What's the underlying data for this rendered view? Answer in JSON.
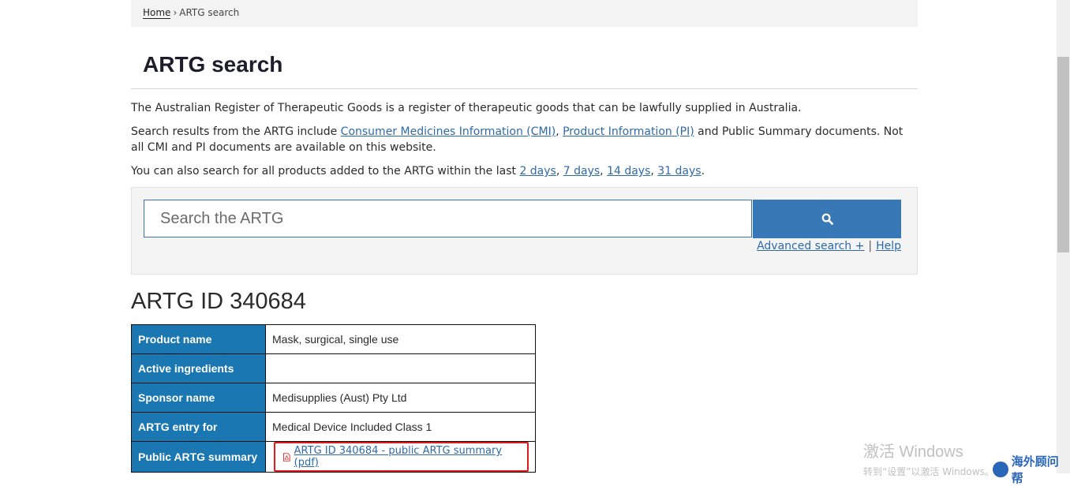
{
  "breadcrumb": {
    "home": "Home",
    "separator": "›",
    "current": "ARTG search"
  },
  "page_title": "ARTG search",
  "intro": {
    "p1": "The Australian Register of Therapeutic Goods is a register of therapeutic goods that can be lawfully supplied in Australia.",
    "p2_before": "Search results from the ARTG include ",
    "cmi_link": "Consumer Medicines Information (CMI)",
    "comma": ", ",
    "pi_link": "Product Information (PI)",
    "p2_after": " and Public Summary documents. Not all CMI and PI documents are available on this website.",
    "p3_before": "You can also search for all products added to the ARTG within the last ",
    "days": [
      "2 days",
      "7 days",
      "14 days",
      "31 days"
    ],
    "days_sep": ", ",
    "p3_end": "."
  },
  "search": {
    "placeholder": "Search the ARTG",
    "button_icon": "search-icon",
    "advanced_link": "Advanced search +",
    "divider": "|",
    "help_link": "Help"
  },
  "result": {
    "heading": "ARTG ID 340684",
    "rows": [
      {
        "label": "Product name",
        "value": "Mask, surgical, single use"
      },
      {
        "label": "Active ingredients",
        "value": ""
      },
      {
        "label": "Sponsor name",
        "value": "Medisupplies (Aust) Pty Ltd"
      },
      {
        "label": "ARTG entry for",
        "value": "Medical Device Included Class 1"
      }
    ],
    "summary_label": "Public ARTG summary",
    "summary_link": "ARTG ID 340684 - public ARTG summary (pdf)",
    "summary_icon": "pdf-icon"
  },
  "watermark": {
    "title": "激活 Windows",
    "subtitle": "转到“设置”以激活 Windows。",
    "brand": "海外顾问帮"
  },
  "colors": {
    "link": "#2f6aa8",
    "button": "#3878b7",
    "table_header": "#1a77b1",
    "highlight": "#e01b1b"
  }
}
